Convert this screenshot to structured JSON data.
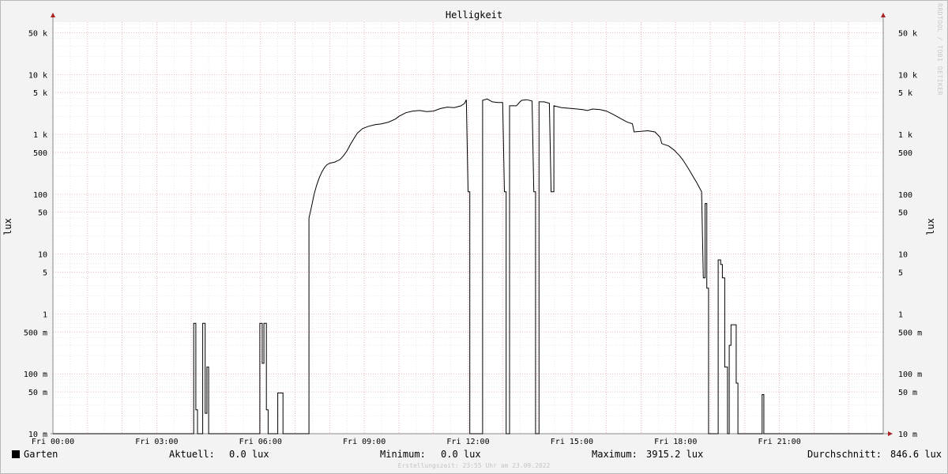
{
  "chart_data": {
    "type": "line",
    "title": "Helligkeit",
    "ylabel": "lux",
    "ylabel_right": "lux",
    "y_scale": "log",
    "ylim": [
      0.01,
      75000
    ],
    "y_ticks": [
      {
        "value": 50000,
        "label": "50 k"
      },
      {
        "value": 10000,
        "label": "10 k"
      },
      {
        "value": 5000,
        "label": "5 k"
      },
      {
        "value": 1000,
        "label": "1 k"
      },
      {
        "value": 500,
        "label": "500"
      },
      {
        "value": 100,
        "label": "100"
      },
      {
        "value": 50,
        "label": "50"
      },
      {
        "value": 10,
        "label": "10"
      },
      {
        "value": 5,
        "label": "5"
      },
      {
        "value": 1,
        "label": "1"
      },
      {
        "value": 0.5,
        "label": "500 m"
      },
      {
        "value": 0.1,
        "label": "100 m"
      },
      {
        "value": 0.05,
        "label": "50 m"
      },
      {
        "value": 0.01,
        "label": "10 m"
      }
    ],
    "x_unit": "hours",
    "xlim": [
      0,
      24
    ],
    "x_ticks": [
      {
        "value": 0,
        "label": "Fri 00:00"
      },
      {
        "value": 3,
        "label": "Fri 03:00"
      },
      {
        "value": 6,
        "label": "Fri 06:00"
      },
      {
        "value": 9,
        "label": "Fri 09:00"
      },
      {
        "value": 12,
        "label": "Fri 12:00"
      },
      {
        "value": 15,
        "label": "Fri 15:00"
      },
      {
        "value": 18,
        "label": "Fri 18:00"
      },
      {
        "value": 21,
        "label": "Fri 21:00"
      }
    ],
    "grid": true,
    "series": [
      {
        "name": "Garten",
        "color": "#000000",
        "points": [
          [
            0.0,
            0.0
          ],
          [
            4.07,
            0.0
          ],
          [
            4.07,
            0.7
          ],
          [
            4.13,
            0.7
          ],
          [
            4.13,
            0.025
          ],
          [
            4.18,
            0.025
          ],
          [
            4.18,
            0.0
          ],
          [
            4.33,
            0.0
          ],
          [
            4.33,
            0.7
          ],
          [
            4.4,
            0.7
          ],
          [
            4.4,
            0.022
          ],
          [
            4.45,
            0.022
          ],
          [
            4.45,
            0.13
          ],
          [
            4.5,
            0.13
          ],
          [
            4.5,
            0.0
          ],
          [
            5.98,
            0.0
          ],
          [
            5.98,
            0.7
          ],
          [
            6.05,
            0.7
          ],
          [
            6.05,
            0.15
          ],
          [
            6.1,
            0.15
          ],
          [
            6.1,
            0.7
          ],
          [
            6.17,
            0.7
          ],
          [
            6.17,
            0.025
          ],
          [
            6.22,
            0.025
          ],
          [
            6.22,
            0.0
          ],
          [
            6.5,
            0.0
          ],
          [
            6.5,
            0.048
          ],
          [
            6.65,
            0.048
          ],
          [
            6.65,
            0.0
          ],
          [
            7.4,
            0.0
          ],
          [
            7.4,
            40
          ],
          [
            7.47,
            60
          ],
          [
            7.55,
            100
          ],
          [
            7.62,
            140
          ],
          [
            7.7,
            190
          ],
          [
            7.78,
            240
          ],
          [
            7.85,
            280
          ],
          [
            7.92,
            310
          ],
          [
            8.0,
            330
          ],
          [
            8.15,
            345
          ],
          [
            8.3,
            380
          ],
          [
            8.4,
            440
          ],
          [
            8.5,
            530
          ],
          [
            8.6,
            680
          ],
          [
            8.7,
            850
          ],
          [
            8.8,
            1050
          ],
          [
            8.95,
            1250
          ],
          [
            9.1,
            1350
          ],
          [
            9.3,
            1450
          ],
          [
            9.5,
            1500
          ],
          [
            9.7,
            1600
          ],
          [
            9.9,
            1800
          ],
          [
            10.0,
            2000
          ],
          [
            10.2,
            2300
          ],
          [
            10.4,
            2450
          ],
          [
            10.6,
            2500
          ],
          [
            10.8,
            2400
          ],
          [
            11.0,
            2450
          ],
          [
            11.2,
            2700
          ],
          [
            11.4,
            2850
          ],
          [
            11.6,
            2800
          ],
          [
            11.8,
            3000
          ],
          [
            11.9,
            3300
          ],
          [
            11.95,
            3800
          ],
          [
            12.0,
            110
          ],
          [
            12.05,
            110
          ],
          [
            12.05,
            0.0
          ],
          [
            12.42,
            0.0
          ],
          [
            12.42,
            3700
          ],
          [
            12.55,
            3900
          ],
          [
            12.7,
            3500
          ],
          [
            12.85,
            3400
          ],
          [
            13.0,
            3400
          ],
          [
            13.05,
            110
          ],
          [
            13.1,
            110
          ],
          [
            13.1,
            0.0
          ],
          [
            13.2,
            0.0
          ],
          [
            13.2,
            3000
          ],
          [
            13.4,
            3000
          ],
          [
            13.5,
            3500
          ],
          [
            13.55,
            3700
          ],
          [
            13.7,
            3800
          ],
          [
            13.85,
            3600
          ],
          [
            13.9,
            110
          ],
          [
            13.95,
            110
          ],
          [
            13.95,
            0.0
          ],
          [
            14.05,
            0.0
          ],
          [
            14.05,
            3500
          ],
          [
            14.2,
            3500
          ],
          [
            14.35,
            3300
          ],
          [
            14.4,
            110
          ],
          [
            14.48,
            110
          ],
          [
            14.48,
            3000
          ],
          [
            14.7,
            2800
          ],
          [
            15.0,
            2700
          ],
          [
            15.3,
            2600
          ],
          [
            15.45,
            2500
          ],
          [
            15.6,
            2650
          ],
          [
            15.8,
            2600
          ],
          [
            16.0,
            2450
          ],
          [
            16.2,
            2150
          ],
          [
            16.4,
            1850
          ],
          [
            16.6,
            1600
          ],
          [
            16.75,
            1500
          ],
          [
            16.8,
            1100
          ],
          [
            17.2,
            1150
          ],
          [
            17.4,
            1100
          ],
          [
            17.55,
            900
          ],
          [
            17.6,
            700
          ],
          [
            17.8,
            640
          ],
          [
            17.95,
            550
          ],
          [
            18.1,
            450
          ],
          [
            18.2,
            380
          ],
          [
            18.3,
            310
          ],
          [
            18.4,
            250
          ],
          [
            18.5,
            200
          ],
          [
            18.6,
            160
          ],
          [
            18.7,
            125
          ],
          [
            18.75,
            110
          ],
          [
            18.8,
            4.0
          ],
          [
            18.85,
            4.0
          ],
          [
            18.85,
            70
          ],
          [
            18.9,
            70
          ],
          [
            18.9,
            2.7
          ],
          [
            18.95,
            2.7
          ],
          [
            18.95,
            0.0
          ],
          [
            19.23,
            0.0
          ],
          [
            19.23,
            8.0
          ],
          [
            19.3,
            8.0
          ],
          [
            19.3,
            6.7
          ],
          [
            19.35,
            6.7
          ],
          [
            19.35,
            4.0
          ],
          [
            19.42,
            4.0
          ],
          [
            19.42,
            0.13
          ],
          [
            19.5,
            0.13
          ],
          [
            19.5,
            0.0
          ],
          [
            19.55,
            0.0
          ],
          [
            19.55,
            0.3
          ],
          [
            19.6,
            0.3
          ],
          [
            19.6,
            0.66
          ],
          [
            19.75,
            0.66
          ],
          [
            19.75,
            0.07
          ],
          [
            19.8,
            0.07
          ],
          [
            19.8,
            0.0
          ],
          [
            20.5,
            0.0
          ],
          [
            20.5,
            0.045
          ],
          [
            20.55,
            0.045
          ],
          [
            20.55,
            0.0
          ],
          [
            24.0,
            0.0
          ]
        ]
      }
    ],
    "legend": [
      {
        "name": "Garten",
        "color": "#000000"
      }
    ],
    "stats": {
      "current_label": "Aktuell:",
      "current_value": "0.0 lux",
      "min_label": "Minimum:",
      "min_value": "0.0 lux",
      "max_label": "Maximum:",
      "max_value": "3915.2 lux",
      "avg_label": "Durchschnitt:",
      "avg_value": "846.6 lux"
    },
    "created_text": "Erstellungszeit: 23:55 Uhr am 23.09.2022",
    "watermark_text": "RRDTOOL / TOBI OETIKER"
  }
}
